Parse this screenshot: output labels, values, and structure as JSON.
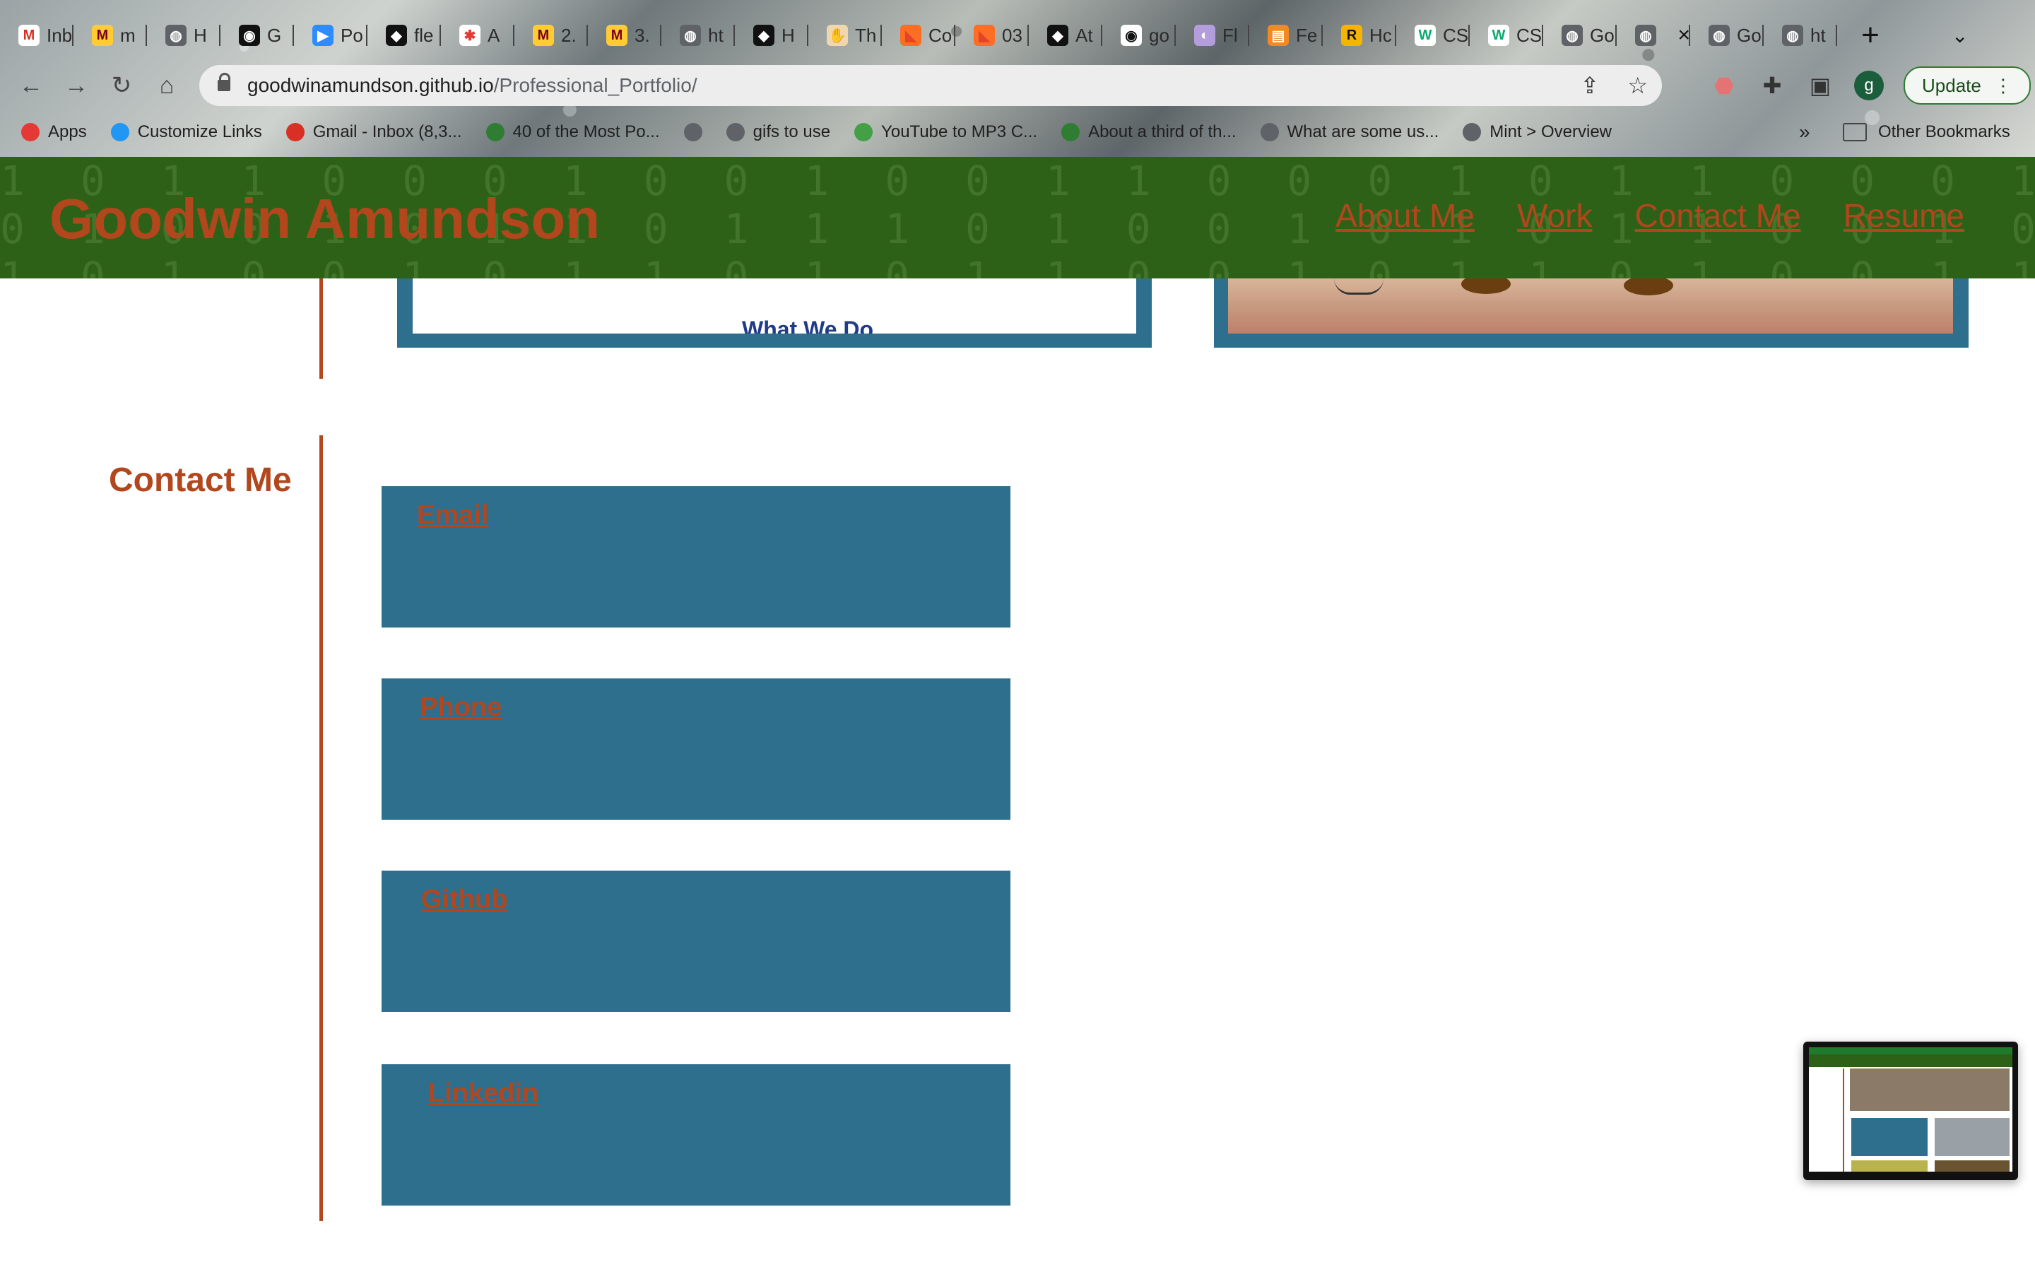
{
  "browser": {
    "tabs": [
      {
        "label": "Inb",
        "icon": "gmail-icon",
        "color": "#ffffff",
        "glyph": "M",
        "glyph_color": "#d93025"
      },
      {
        "label": "m",
        "icon": "umn-icon",
        "color": "#ffcc33",
        "glyph": "M",
        "glyph_color": "#7a0019"
      },
      {
        "label": "H",
        "icon": "globe-icon",
        "color": "#5f6368",
        "glyph": "◍",
        "glyph_color": "#ffffff"
      },
      {
        "label": "G",
        "icon": "github-icon",
        "color": "#111111",
        "glyph": "◉",
        "glyph_color": "#ffffff"
      },
      {
        "label": "Po",
        "icon": "zoom-icon",
        "color": "#2d8cff",
        "glyph": "▶",
        "glyph_color": "#ffffff"
      },
      {
        "label": "fle",
        "icon": "codecademy-icon",
        "color": "#111111",
        "glyph": "◆",
        "glyph_color": "#ffffff"
      },
      {
        "label": "A",
        "icon": "asterisk-icon",
        "color": "#ffffff",
        "glyph": "✱",
        "glyph_color": "#e53935"
      },
      {
        "label": "2.",
        "icon": "umn-icon",
        "color": "#ffcc33",
        "glyph": "M",
        "glyph_color": "#7a0019"
      },
      {
        "label": "3.",
        "icon": "umn-icon",
        "color": "#ffcc33",
        "glyph": "M",
        "glyph_color": "#7a0019"
      },
      {
        "label": "ht",
        "icon": "globe-icon",
        "color": "#5f6368",
        "glyph": "◍",
        "glyph_color": "#ffffff"
      },
      {
        "label": "H",
        "icon": "codecademy-icon",
        "color": "#111111",
        "glyph": "◆",
        "glyph_color": "#ffffff"
      },
      {
        "label": "Th",
        "icon": "hand-icon",
        "color": "#f1d7b0",
        "glyph": "✋",
        "glyph_color": "#8a5a2b"
      },
      {
        "label": "Co",
        "icon": "gitlab-icon",
        "color": "#fc6d26",
        "glyph": "◣",
        "glyph_color": "#e24329"
      },
      {
        "label": "03",
        "icon": "gitlab-icon",
        "color": "#fc6d26",
        "glyph": "◣",
        "glyph_color": "#e24329"
      },
      {
        "label": "At",
        "icon": "codecademy-icon",
        "color": "#111111",
        "glyph": "◆",
        "glyph_color": "#ffffff"
      },
      {
        "label": "go",
        "icon": "github-icon",
        "color": "#ffffff",
        "glyph": "◉",
        "glyph_color": "#111111"
      },
      {
        "label": "Fl",
        "icon": "flow-icon",
        "color": "#b39ddb",
        "glyph": "◐",
        "glyph_color": "#ffffff"
      },
      {
        "label": "Fe",
        "icon": "book-icon",
        "color": "#f08a24",
        "glyph": "▤",
        "glyph_color": "#ffffff"
      },
      {
        "label": "Hc",
        "icon": "r-icon",
        "color": "#f5b400",
        "glyph": "R",
        "glyph_color": "#111111"
      },
      {
        "label": "CS",
        "icon": "w3schools-icon",
        "color": "#ffffff",
        "glyph": "W",
        "glyph_color": "#04aa6d"
      },
      {
        "label": "CS",
        "icon": "w3schools-icon",
        "color": "#ffffff",
        "glyph": "W",
        "glyph_color": "#04aa6d"
      },
      {
        "label": "Go",
        "icon": "globe-icon",
        "color": "#5f6368",
        "glyph": "◍",
        "glyph_color": "#ffffff"
      },
      {
        "label": "",
        "icon": "globe-icon",
        "color": "#5f6368",
        "glyph": "◍",
        "glyph_color": "#ffffff",
        "active": true
      },
      {
        "label": "Go",
        "icon": "globe-icon",
        "color": "#5f6368",
        "glyph": "◍",
        "glyph_color": "#ffffff"
      },
      {
        "label": "ht",
        "icon": "globe-icon",
        "color": "#5f6368",
        "glyph": "◍",
        "glyph_color": "#ffffff"
      }
    ],
    "new_tab": "+",
    "url_host": "goodwinamundson.github.io",
    "url_path": "/Professional_Portfolio/",
    "profile_initial": "g",
    "update_label": "Update",
    "bookmarks": [
      {
        "label": "Apps",
        "icon": "apps-grid-icon",
        "color": "#e53935"
      },
      {
        "label": "Customize Links",
        "icon": "windows-icon",
        "color": "#2196f3"
      },
      {
        "label": "Gmail - Inbox (8,3...",
        "icon": "gmail-icon",
        "color": "#d93025"
      },
      {
        "label": "40 of the Most Po...",
        "icon": "image-icon",
        "color": "#2e7d32"
      },
      {
        "label": "",
        "icon": "globe-icon",
        "color": "#5f6368"
      },
      {
        "label": "gifs to use",
        "icon": "globe-icon",
        "color": "#5f6368"
      },
      {
        "label": "YouTube to MP3 C...",
        "icon": "heart-icon",
        "color": "#43a047"
      },
      {
        "label": "About a third of th...",
        "icon": "image-icon",
        "color": "#2e7d32"
      },
      {
        "label": "What are some us...",
        "icon": "globe-icon",
        "color": "#5f6368"
      },
      {
        "label": "Mint > Overview",
        "icon": "globe-icon",
        "color": "#5f6368"
      }
    ],
    "bookmarks_more": "»",
    "other_bookmarks": "Other Bookmarks"
  },
  "site": {
    "name": "Goodwin Amundson",
    "nav": [
      "About Me",
      "Work",
      "Contact Me",
      "Resume"
    ],
    "header_bg": "#2e6118",
    "accent": "#b2461d",
    "card_color": "#2e6f8e",
    "work_card_caption": "What We Do",
    "contact": {
      "heading": "Contact Me",
      "links": [
        "Email",
        "Phone",
        "Github",
        "Linkedin"
      ]
    }
  }
}
